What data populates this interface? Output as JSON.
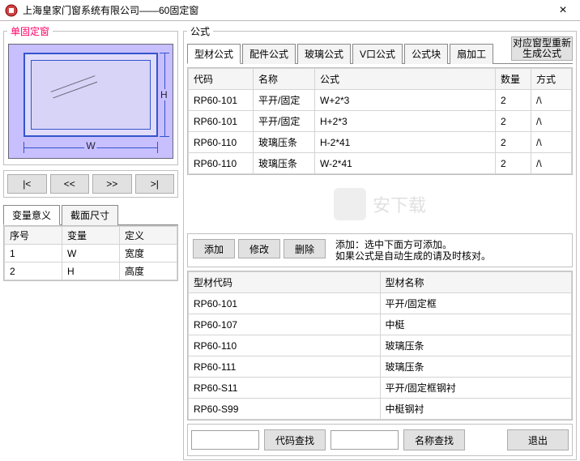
{
  "window": {
    "title": "上海皇家门窗系统有限公司——60固定窗",
    "close": "×"
  },
  "left": {
    "legend": "单固定窗",
    "dimW": "W",
    "dimH": "H",
    "nav": {
      "first": "|<",
      "prev": "<<",
      "next": ">>",
      "last": ">|"
    },
    "tabs": {
      "varmean": "变量意义",
      "section": "截面尺寸"
    },
    "varTable": {
      "headers": {
        "no": "序号",
        "var": "变量",
        "def": "定义"
      },
      "rows": [
        {
          "no": "1",
          "var": "W",
          "def": "宽度"
        },
        {
          "no": "2",
          "var": "H",
          "def": "高度"
        }
      ]
    }
  },
  "formula": {
    "legend": "公式",
    "regen": "对应窗型重新生成公式",
    "tabs": [
      "型材公式",
      "配件公式",
      "玻璃公式",
      "V口公式",
      "公式块",
      "扇加工"
    ],
    "activeTab": 0,
    "headers": {
      "code": "代码",
      "name": "名称",
      "formula": "公式",
      "qty": "数量",
      "mode": "方式"
    },
    "rows": [
      {
        "code": "RP60-101",
        "name": "平开/固定",
        "formula": "W+2*3",
        "qty": "2",
        "mode": "/\\"
      },
      {
        "code": "RP60-101",
        "name": "平开/固定",
        "formula": "H+2*3",
        "qty": "2",
        "mode": "/\\"
      },
      {
        "code": "RP60-110",
        "name": "玻璃压条",
        "formula": "H-2*41",
        "qty": "2",
        "mode": "/\\"
      },
      {
        "code": "RP60-110",
        "name": "玻璃压条",
        "formula": "W-2*41",
        "qty": "2",
        "mode": "/\\"
      }
    ]
  },
  "actions": {
    "add": "添加",
    "edit": "修改",
    "del": "删除",
    "hint1": "添加：选中下面方可添加。",
    "hint2": "如果公式是自动生成的请及时核对。"
  },
  "profiles": {
    "headers": {
      "code": "型材代码",
      "name": "型材名称"
    },
    "rows": [
      {
        "code": "RP60-101",
        "name": "平开/固定框"
      },
      {
        "code": "RP60-107",
        "name": "中梃"
      },
      {
        "code": "RP60-110",
        "name": "玻璃压条"
      },
      {
        "code": "RP60-111",
        "name": "玻璃压条"
      },
      {
        "code": "RP60-S11",
        "name": "平开/固定框钢衬"
      },
      {
        "code": "RP60-S99",
        "name": "中梃钢衬"
      }
    ]
  },
  "bottom": {
    "codeSearch": "代码查找",
    "nameSearch": "名称查找",
    "exit": "退出"
  },
  "watermark": "安下载"
}
